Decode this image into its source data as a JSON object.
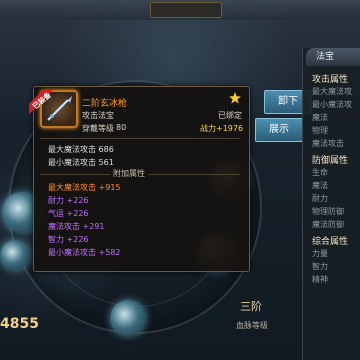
{
  "item": {
    "name": "二阶玄冰枪",
    "type": "攻击法宝",
    "level_label": "穿戴等级",
    "level_value": "80",
    "bound": "已绑定",
    "power": "战力+1976",
    "equipped_badge": "已装备",
    "name_color": "#ff9a2e"
  },
  "base_stats": [
    {
      "label": "最大魔法攻击 686"
    },
    {
      "label": "最小魔法攻击 561"
    }
  ],
  "extra_title": "附加属性",
  "extra_stats": [
    {
      "text": "最大魔法攻击 +915",
      "color": "#ff8c2a"
    },
    {
      "text": "耐力 +226",
      "color": "#c070ff"
    },
    {
      "text": "气运 +226",
      "color": "#c070ff"
    },
    {
      "text": "魔法攻击 +291",
      "color": "#c070ff"
    },
    {
      "text": "智力 +226",
      "color": "#c070ff"
    },
    {
      "text": "最小魔法攻击 +582",
      "color": "#c070ff"
    }
  ],
  "buttons": {
    "unequip": "卸下",
    "show": "展示"
  },
  "side_panel": {
    "tab": "法宝",
    "sections": [
      {
        "type": "head",
        "text": "攻击属性"
      },
      {
        "type": "item",
        "text": "最大魔法攻"
      },
      {
        "type": "item",
        "text": "最小魔法攻"
      },
      {
        "type": "item",
        "text": "魔法"
      },
      {
        "type": "item",
        "text": "物理"
      },
      {
        "type": "item",
        "text": "魔法攻击"
      },
      {
        "type": "head",
        "text": "防御属性"
      },
      {
        "type": "item",
        "text": "生命"
      },
      {
        "type": "item",
        "text": "魔法"
      },
      {
        "type": "item",
        "text": "耐力"
      },
      {
        "type": "item",
        "text": "物理防御"
      },
      {
        "type": "item",
        "text": "魔法防御"
      },
      {
        "type": "head",
        "text": "综合属性"
      },
      {
        "type": "item",
        "text": "力量"
      },
      {
        "type": "item",
        "text": "智力"
      },
      {
        "type": "item",
        "text": "精神"
      }
    ]
  },
  "bottom": {
    "score": "4855",
    "stage_value": "三阶",
    "stage_label": "血脉等级"
  },
  "colors": {
    "accent_orange": "#ff9a2e",
    "power_gold": "#ffd34a",
    "purple_attr": "#c070ff",
    "button_blue": "#2a5c78"
  }
}
